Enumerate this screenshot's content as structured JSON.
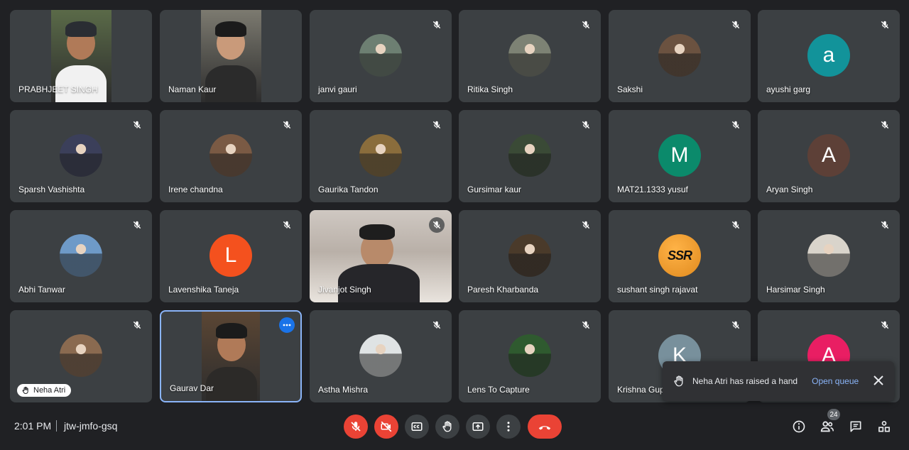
{
  "participants": [
    {
      "name": "PRABHJEET SINGH",
      "kind": "video",
      "color": "#5a6a48"
    },
    {
      "name": "Naman Kaur",
      "kind": "video",
      "color": "#7c7a70"
    },
    {
      "name": "janvi gauri",
      "kind": "photo",
      "color": "#6d7f72",
      "muted": true
    },
    {
      "name": "Ritika Singh",
      "kind": "photo",
      "color": "#7d8274",
      "muted": true
    },
    {
      "name": "Sakshi",
      "kind": "photo",
      "color": "#6b5240",
      "muted": true
    },
    {
      "name": "ayushi garg",
      "kind": "letter",
      "letter": "a",
      "color": "#12939a",
      "muted": true
    },
    {
      "name": "Sparsh Vashishta",
      "kind": "photo",
      "color": "#3b3f5a",
      "muted": true
    },
    {
      "name": "Irene chandna",
      "kind": "photo",
      "color": "#7a5a44",
      "muted": true
    },
    {
      "name": "Gaurika Tandon",
      "kind": "photo",
      "color": "#8a6d3c",
      "muted": true
    },
    {
      "name": "Gursimar kaur",
      "kind": "photo",
      "color": "#3a4a36",
      "muted": true
    },
    {
      "name": "MAT21.1333 yusuf",
      "kind": "letter",
      "letter": "M",
      "color": "#0b8a6b",
      "muted": true
    },
    {
      "name": "Aryan Singh",
      "kind": "letter",
      "letter": "A",
      "color": "#5d4037",
      "muted": true
    },
    {
      "name": "Abhi Tanwar",
      "kind": "photo",
      "color": "#6e9ac8",
      "muted": true
    },
    {
      "name": "Lavenshika Taneja",
      "kind": "letter",
      "letter": "L",
      "color": "#f4511e",
      "muted": true
    },
    {
      "name": "Jivanjot Singh",
      "kind": "video",
      "color": "#d8d2cc",
      "muted": true
    },
    {
      "name": "Paresh Kharbanda",
      "kind": "photo",
      "color": "#4a3a2a",
      "muted": true
    },
    {
      "name": "sushant singh rajavat",
      "kind": "logo",
      "logo_text": "SSR",
      "color": "#e08a1e",
      "muted": true
    },
    {
      "name": "Harsimar Singh",
      "kind": "photo",
      "color": "#d9d4cb",
      "muted": true
    },
    {
      "name": "",
      "kind": "photo",
      "color": "#8a6a50",
      "muted": true,
      "hand": "Neha Atri"
    },
    {
      "name": "Gaurav Dar",
      "kind": "video",
      "color": "#5b4634",
      "active": true
    },
    {
      "name": "Astha Mishra",
      "kind": "photo",
      "color": "#dfe3e4",
      "muted": true
    },
    {
      "name": "Lens To Capture",
      "kind": "photo",
      "color": "#2f5a2f",
      "muted": true
    },
    {
      "name": "Krishna Gup",
      "kind": "letter",
      "letter": "K",
      "color": "#78909c",
      "muted": true
    },
    {
      "name": "",
      "kind": "letter",
      "letter": "A",
      "color": "#e91e63",
      "muted": true
    }
  ],
  "colors": {
    "mic_muted": "#ea4335",
    "accent": "#8ab4f8",
    "tile": "#3c4043"
  },
  "notification": {
    "text": "Neha Atri has raised a hand",
    "action": "Open queue"
  },
  "meeting": {
    "time": "2:01 PM",
    "code": "jtw-jmfo-gsq",
    "participant_count": "24"
  },
  "controls": [
    "mic-off-icon",
    "camera-off-icon",
    "captions-icon",
    "raise-hand-icon",
    "present-icon",
    "more-options-icon",
    "end-call-icon"
  ],
  "right_controls": [
    "info-icon",
    "people-icon",
    "chat-icon",
    "activities-icon"
  ]
}
